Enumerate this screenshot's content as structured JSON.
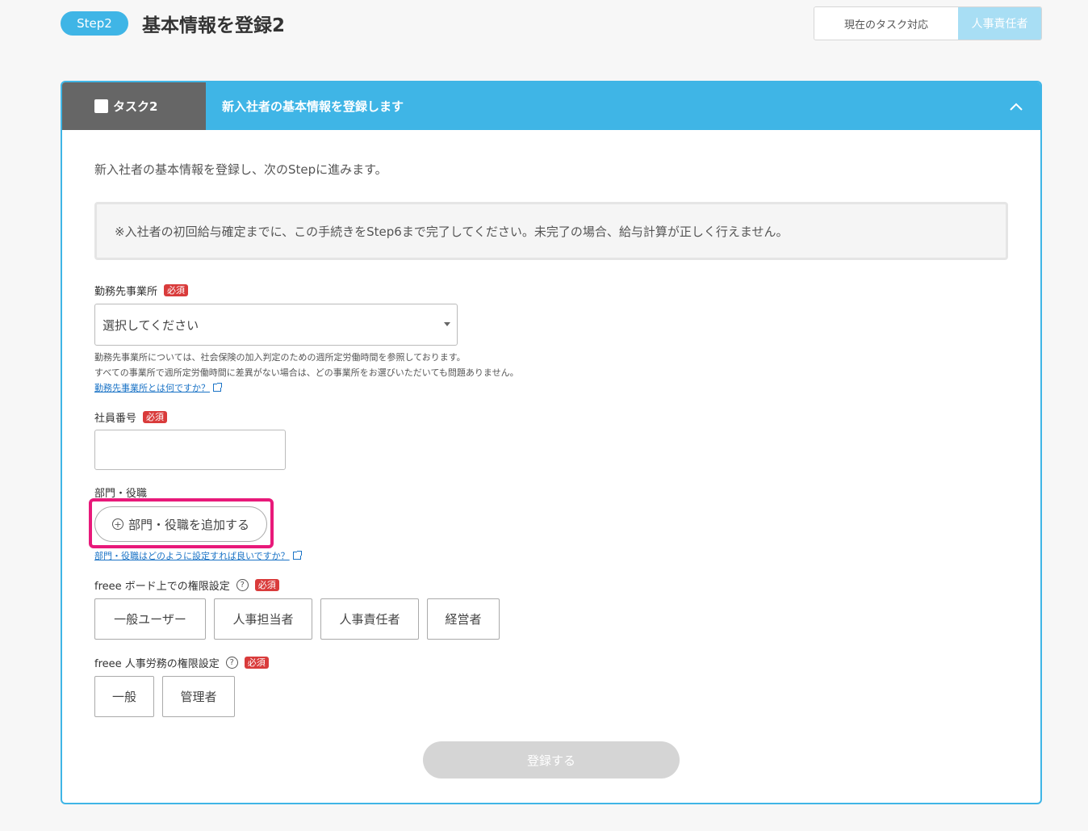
{
  "step": {
    "badge": "Step2",
    "title": "基本情報を登録2"
  },
  "role_switch": {
    "current_task_label": "現在のタスク対応",
    "role": "人事責任者"
  },
  "task": {
    "tag": "タスク2",
    "header": "新入社者の基本情報を登録します",
    "intro": "新入社者の基本情報を登録し、次のStepに進みます。",
    "notice": "※入社者の初回給与確定までに、この手続きをStep6まで完了してください。未完了の場合、給与計算が正しく行えません。"
  },
  "required_label": "必須",
  "office": {
    "label": "勤務先事業所",
    "placeholder": "選択してください",
    "hint1": "勤務先事業所については、社会保険の加入判定のための週所定労働時間を参照しております。",
    "hint2": "すべての事業所で週所定労働時間に差異がない場合は、どの事業所をお選びいただいても問題ありません。",
    "link": "勤務先事業所とは何ですか？"
  },
  "employee_no": {
    "label": "社員番号",
    "value": ""
  },
  "dept": {
    "label": "部門・役職",
    "add_button": "部門・役職を追加する",
    "link": "部門・役職はどのように設定すれば良いですか？"
  },
  "board_perm": {
    "label": "freee ボード上での権限設定",
    "help": "?",
    "options": [
      "一般ユーザー",
      "人事担当者",
      "人事責任者",
      "経営者"
    ]
  },
  "hr_perm": {
    "label": "freee 人事労務の権限設定",
    "help": "?",
    "options": [
      "一般",
      "管理者"
    ]
  },
  "submit": "登録する",
  "colors": {
    "accent": "#3fb5e6",
    "required": "#d93b3b",
    "highlight": "#e8197a",
    "task_tag": "#666666"
  }
}
